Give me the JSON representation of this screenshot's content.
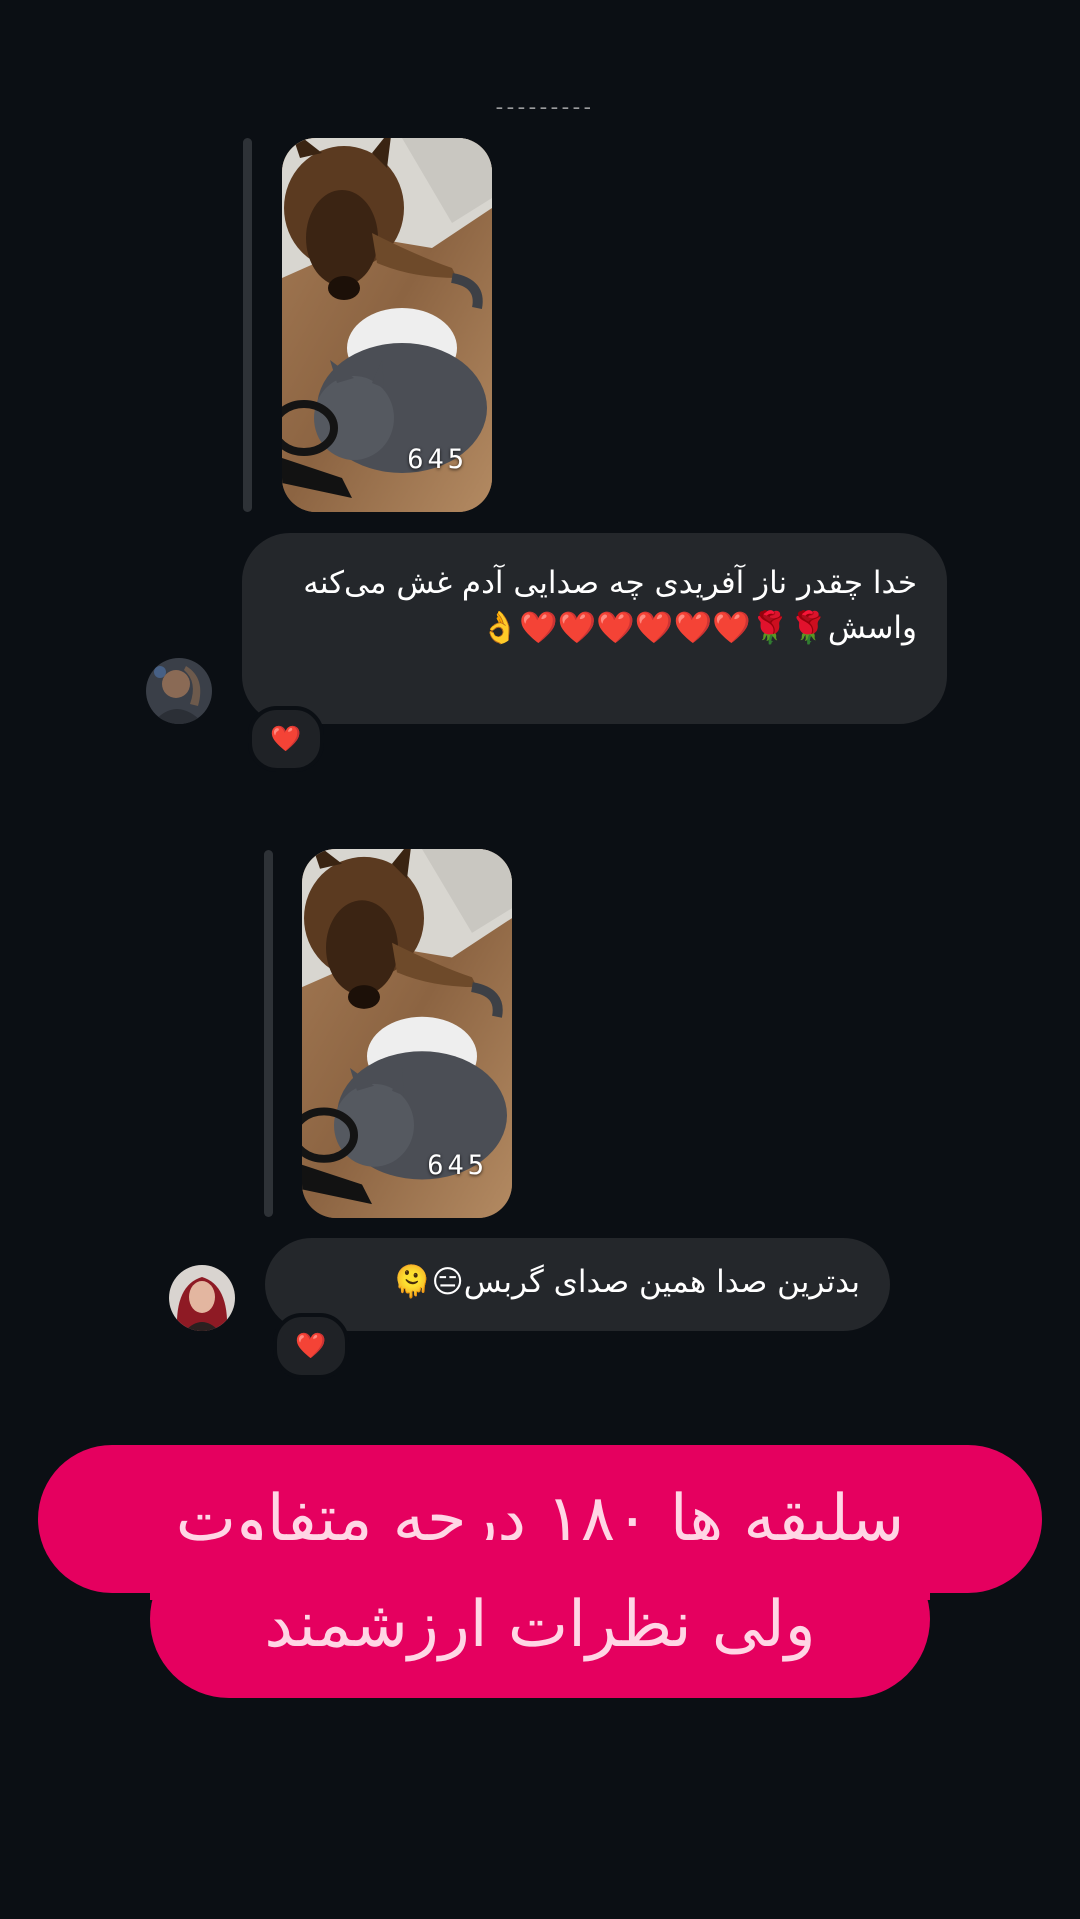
{
  "messages": [
    {
      "story_views": "645",
      "text": "خدا چقدر ناز آفریدی چه صدایی آدم غش می‌کنه واسش🌹🌹❤️❤️❤️❤️❤️❤️👌",
      "reaction": "❤️",
      "avatar_icon": "user-avatar-icon"
    },
    {
      "story_views": "645",
      "text": "بدترین صدا همین صدای گربس😑🫠",
      "reaction": "❤️",
      "avatar_icon": "user-avatar-icon"
    }
  ],
  "banner": {
    "line1": "سلیقه ها ۱۸۰ درجه متفاوت",
    "line2": "ولی نظرات ارزشمند"
  },
  "colors": {
    "background": "#0b0f14",
    "bubble": "#24272b",
    "banner": "#e5005f",
    "banner_text": "#ffd6e5",
    "reaction": "#e0245e"
  }
}
